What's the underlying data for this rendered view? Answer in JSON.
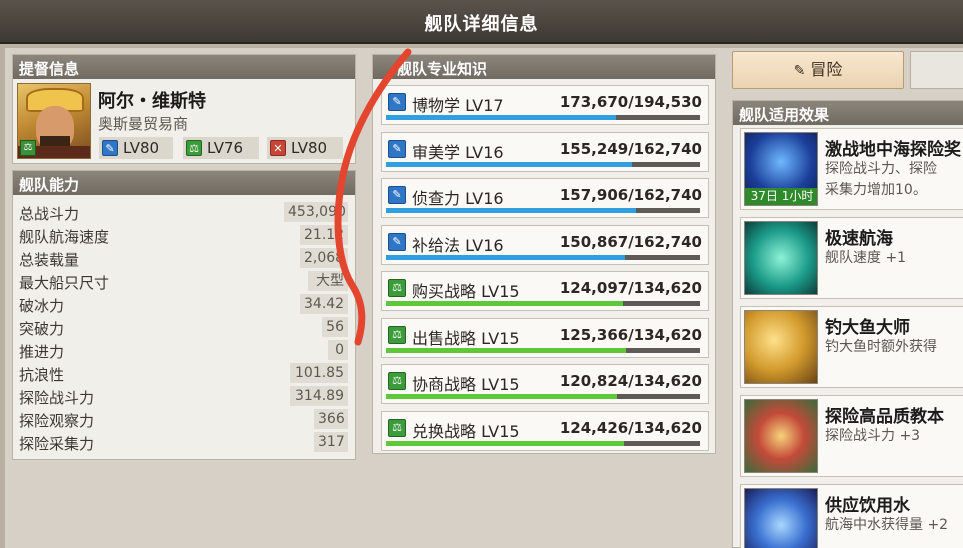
{
  "window": {
    "title": "舰队详细信息"
  },
  "admiral": {
    "header": "提督信息",
    "name": "阿尔・维斯特",
    "role": "奥斯曼贸易商",
    "skills": [
      {
        "icon": "quill-icon",
        "color": "#2f77c6",
        "label": "LV80"
      },
      {
        "icon": "scale-icon",
        "color": "#3c9b3a",
        "label": "LV76"
      },
      {
        "icon": "swords-icon",
        "color": "#c84637",
        "label": "LV80"
      }
    ]
  },
  "ability": {
    "header": "舰队能力",
    "rows": [
      {
        "label": "总战斗力",
        "value": "453,090"
      },
      {
        "label": "舰队航海速度",
        "value": "21.12"
      },
      {
        "label": "总装载量",
        "value": "2,068"
      },
      {
        "label": "最大船只尺寸",
        "value": "大型"
      },
      {
        "label": "破冰力",
        "value": "34.42"
      },
      {
        "label": "突破力",
        "value": "56"
      },
      {
        "label": "推进力",
        "value": "0"
      },
      {
        "label": "抗浪性",
        "value": "101.85"
      },
      {
        "label": "探险战斗力",
        "value": "314.89"
      },
      {
        "label": "探险观察力",
        "value": "366"
      },
      {
        "label": "探险采集力",
        "value": "317"
      }
    ]
  },
  "knowledge": {
    "header": "舰队专业知识",
    "rows": [
      {
        "icon": "quill-icon",
        "kind": "blue",
        "name": "博物学 LV17",
        "value": "173,670/194,530",
        "progress": 0.893
      },
      {
        "icon": "quill-icon",
        "kind": "blue",
        "name": "审美学 LV16",
        "value": "155,249/162,740",
        "progress": 0.954
      },
      {
        "icon": "quill-icon",
        "kind": "blue",
        "name": "侦查力 LV16",
        "value": "157,906/162,740",
        "progress": 0.97
      },
      {
        "icon": "quill-icon",
        "kind": "blue",
        "name": "补给法 LV16",
        "value": "150,867/162,740",
        "progress": 0.927
      },
      {
        "icon": "scale-icon",
        "kind": "green",
        "name": "购买战略 LV15",
        "value": "124,097/134,620",
        "progress": 0.922
      },
      {
        "icon": "scale-icon",
        "kind": "green",
        "name": "出售战略 LV15",
        "value": "125,366/134,620",
        "progress": 0.931
      },
      {
        "icon": "scale-icon",
        "kind": "green",
        "name": "协商战略 LV15",
        "value": "120,824/134,620",
        "progress": 0.897
      },
      {
        "icon": "scale-icon",
        "kind": "green",
        "name": "兑换战略 LV15",
        "value": "124,426/134,620",
        "progress": 0.924
      }
    ]
  },
  "right": {
    "adventure_label": "冒险",
    "effects_header": "舰队适用效果",
    "effects": [
      {
        "icon": "spyglass-icon",
        "title": "激战地中海探险奖",
        "desc": "探险战斗力、探险",
        "desc2": "采集力增加10。",
        "timer": "37日 1小时"
      },
      {
        "icon": "ship-icon",
        "title": "极速航海",
        "desc": "舰队速度 +1",
        "desc2": ""
      },
      {
        "icon": "fishing-rod-icon",
        "title": "钓大鱼大师",
        "desc": "钓大鱼时额外获得",
        "desc2": ""
      },
      {
        "icon": "book-icon",
        "title": "探险高品质教本",
        "desc": "探险战斗力 +3",
        "desc2": ""
      },
      {
        "icon": "water-icon",
        "title": "供应饮用水",
        "desc": "航海中水获得量 +2",
        "desc2": ""
      }
    ]
  },
  "colors": {
    "accent_blue": "#2f9fe0",
    "accent_green": "#5cc83a",
    "annotation": "#e3452f"
  }
}
